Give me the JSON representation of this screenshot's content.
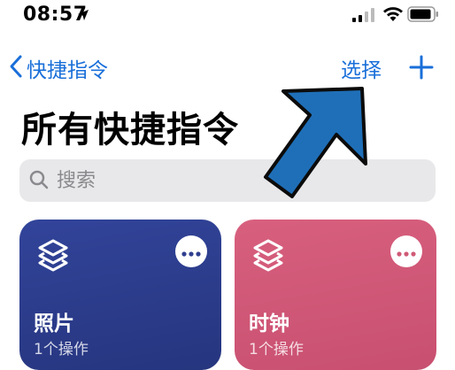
{
  "status_bar": {
    "time": "08:57"
  },
  "nav": {
    "back_label": "快捷指令",
    "select_label": "选择"
  },
  "page": {
    "title": "所有快捷指令"
  },
  "search": {
    "placeholder": "搜索"
  },
  "cards": [
    {
      "title": "照片",
      "subtitle": "1个操作",
      "color": "#2f3f8f",
      "icon": "shortcuts-layers-icon"
    },
    {
      "title": "时钟",
      "subtitle": "1个操作",
      "color": "#d05a77",
      "icon": "shortcuts-layers-icon"
    }
  ],
  "colors": {
    "accent": "#1a6fd9",
    "annotation_arrow": "#1f6fb8"
  }
}
